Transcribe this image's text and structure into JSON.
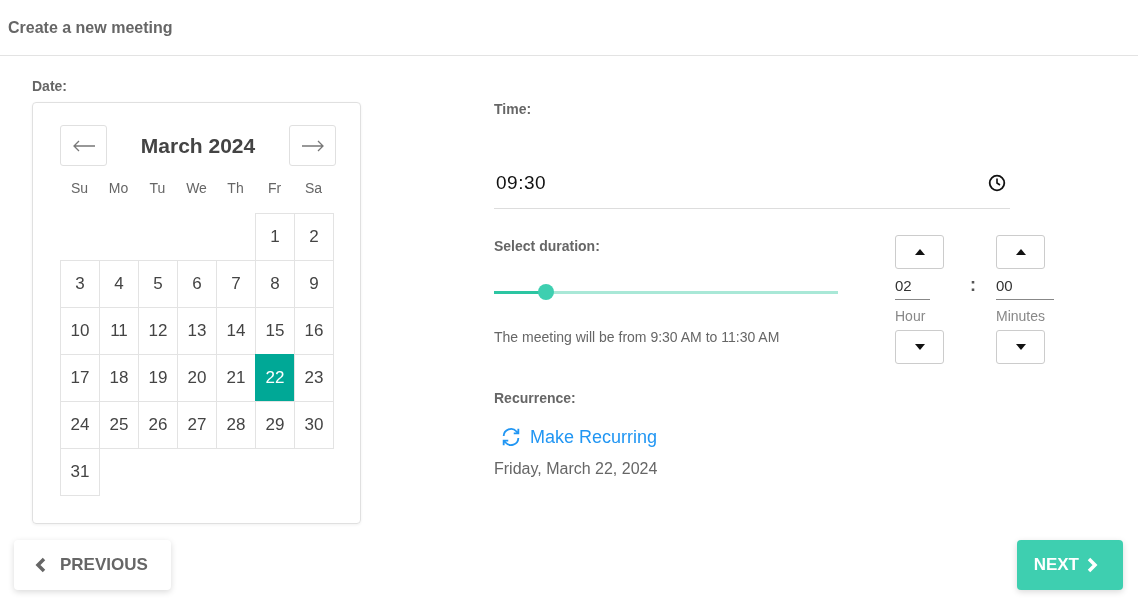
{
  "header": {
    "title": "Create a new meeting"
  },
  "date": {
    "label": "Date:",
    "month": "March 2024",
    "weekdays": [
      "Su",
      "Mo",
      "Tu",
      "We",
      "Th",
      "Fr",
      "Sa"
    ],
    "weeks": [
      {
        "kind": "trailing",
        "days": [
          {
            "day": "1",
            "selected": false
          },
          {
            "day": "2",
            "selected": false
          }
        ]
      },
      {
        "kind": "leading",
        "days": [
          {
            "day": "3",
            "selected": false
          },
          {
            "day": "4",
            "selected": false
          },
          {
            "day": "5",
            "selected": false
          },
          {
            "day": "6",
            "selected": false
          },
          {
            "day": "7",
            "selected": false
          },
          {
            "day": "8",
            "selected": false
          },
          {
            "day": "9",
            "selected": false
          }
        ]
      },
      {
        "kind": "leading",
        "days": [
          {
            "day": "10",
            "selected": false
          },
          {
            "day": "11",
            "selected": false
          },
          {
            "day": "12",
            "selected": false
          },
          {
            "day": "13",
            "selected": false
          },
          {
            "day": "14",
            "selected": false
          },
          {
            "day": "15",
            "selected": false
          },
          {
            "day": "16",
            "selected": false
          }
        ]
      },
      {
        "kind": "leading",
        "days": [
          {
            "day": "17",
            "selected": false
          },
          {
            "day": "18",
            "selected": false
          },
          {
            "day": "19",
            "selected": false
          },
          {
            "day": "20",
            "selected": false
          },
          {
            "day": "21",
            "selected": false
          },
          {
            "day": "22",
            "selected": true
          },
          {
            "day": "23",
            "selected": false
          }
        ]
      },
      {
        "kind": "leading",
        "days": [
          {
            "day": "24",
            "selected": false
          },
          {
            "day": "25",
            "selected": false
          },
          {
            "day": "26",
            "selected": false
          },
          {
            "day": "27",
            "selected": false
          },
          {
            "day": "28",
            "selected": false
          },
          {
            "day": "29",
            "selected": false
          },
          {
            "day": "30",
            "selected": false
          }
        ]
      },
      {
        "kind": "leading",
        "days": [
          {
            "day": "31",
            "selected": false
          }
        ]
      }
    ]
  },
  "time": {
    "label": "Time:",
    "value": "09:30"
  },
  "duration": {
    "label": "Select duration:",
    "level": 0.15,
    "summary": "The meeting will be from 9:30 AM to 11:30 AM",
    "separator": ":",
    "spinners": [
      {
        "value": "02",
        "label": "Hour"
      },
      {
        "value": "00",
        "label": "Minutes"
      }
    ]
  },
  "recurrence": {
    "label": "Recurrence:",
    "link": "Make Recurring",
    "date_text": "Friday, March 22, 2024"
  },
  "buttons": {
    "previous": "PREVIOUS",
    "next": "NEXT"
  }
}
